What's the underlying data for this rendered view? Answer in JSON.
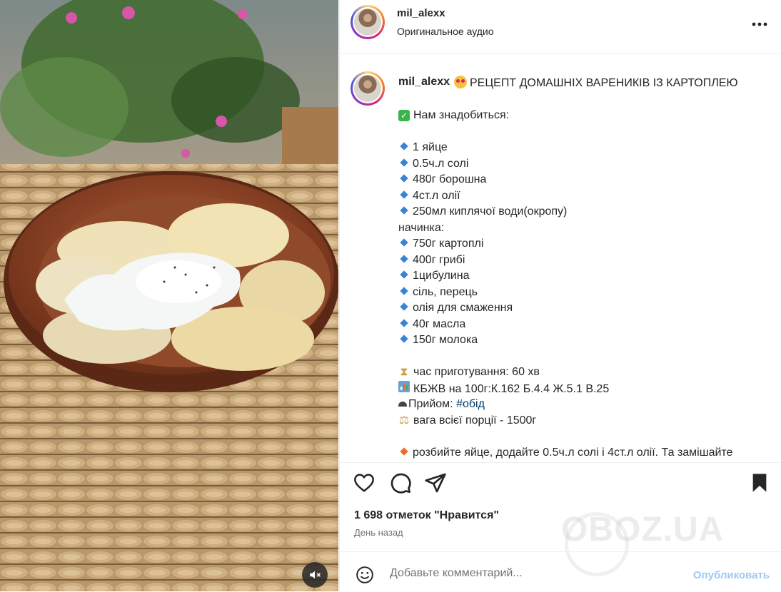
{
  "post": {
    "username": "mil_alexx",
    "audio": "Оригинальное аудио"
  },
  "caption": {
    "username": "mil_alexx",
    "title": "РЕЦЕПТ ДОМАШНІХ ВАРЕНИКІВ ІЗ КАРТОПЛЕЮ",
    "need": "Нам знадобиться:",
    "dough": [
      "1 яйце",
      "0.5ч.л солі",
      "480г борошна",
      "4ст.л олії",
      "250мл киплячої води(окропу)"
    ],
    "filling_label": "начинка:",
    "filling": [
      "750г картоплі",
      "400г грибі",
      "1цибулина",
      "сіль, перець",
      "олія для смаження",
      "40г масла",
      "150г молока"
    ],
    "time": "час приготування: 60 хв",
    "kbzhv": "КБЖВ на 100г:К.162 Б.4.4 Ж.5.1 В.25",
    "meal_prefix": "Прийом:",
    "meal_tag": "#обід",
    "weight": "вага всієї порції - 1500г",
    "step1": "розбийте яйце, додайте 0.5ч.л солі і 4ст.л олії. Та замішайте"
  },
  "stats": {
    "likes": "1 698 отметок \"Нравится\"",
    "posted": "День назад"
  },
  "comment": {
    "placeholder": "Добавьте комментарий...",
    "publish": "Опубликовать"
  },
  "watermark": "OBOZ.UA",
  "icons": {
    "more": "more-horizontal-icon",
    "like": "heart-icon",
    "comment": "comment-icon",
    "share": "paper-plane-icon",
    "save": "bookmark-filled-icon",
    "emoji": "smiley-icon",
    "mute": "speaker-muted-icon"
  },
  "colors": {
    "link": "#00376b",
    "publish": "#9ec9f5",
    "bullet_blue": "#3b82d6",
    "bullet_orange": "#f06b2b"
  }
}
